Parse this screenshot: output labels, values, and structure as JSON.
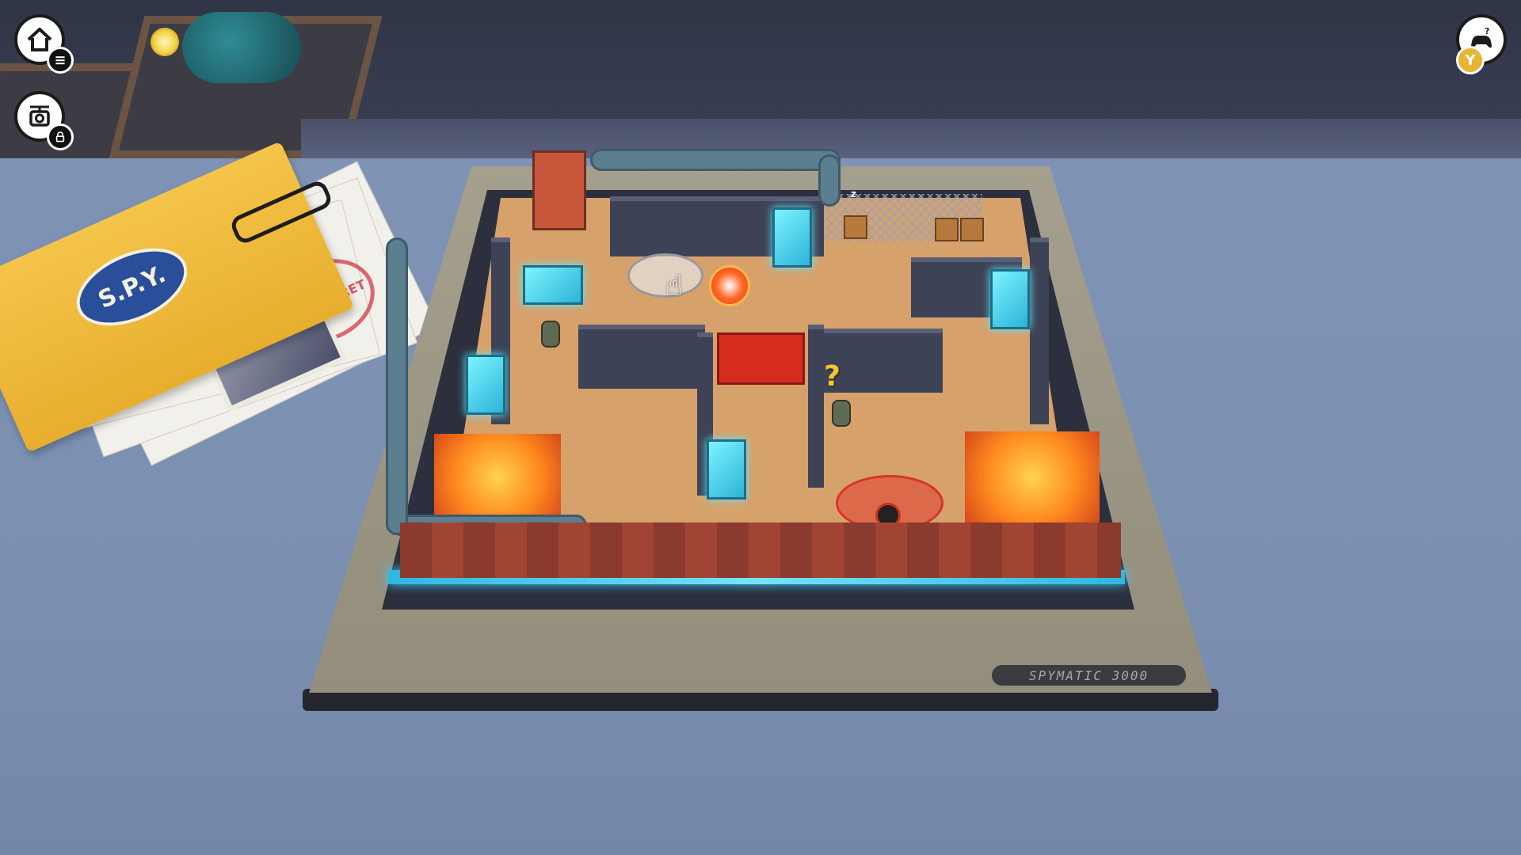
{
  "hud": {
    "home_button_icon": "home-icon",
    "menu_badge_icon": "menu-icon",
    "camera_button_icon": "camera-drone-icon",
    "lock_badge_icon": "lock-icon",
    "controller_help_icon": "controller-help-icon",
    "controller_help_key": "Y"
  },
  "props": {
    "folder_logo": "S.P.Y.",
    "stamp_text": "TOP SECRET",
    "console_brand": "SPYMATIC 3000",
    "sleep_marker": "z"
  },
  "board": {
    "question_marker": "?"
  },
  "colors": {
    "neon": "#38d0ff",
    "lava": "#ff8a1e",
    "floor": "#d7a16c",
    "desk": "#7e93b5",
    "y_badge": "#e7b531"
  }
}
